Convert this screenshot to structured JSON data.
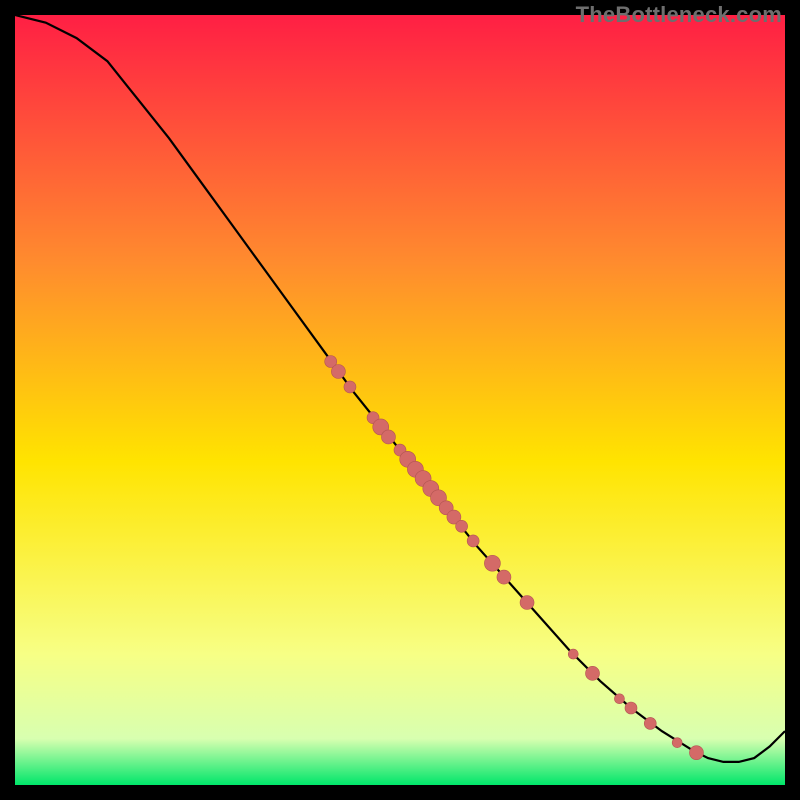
{
  "watermark": "TheBottleneck.com",
  "colors": {
    "gradient_top": "#ff1f44",
    "gradient_mid_upper": "#ff8b2e",
    "gradient_mid": "#ffe400",
    "gradient_lower": "#f7ff85",
    "gradient_near_bottom": "#d8ffb0",
    "gradient_bottom": "#00e66a",
    "line": "#000000",
    "point_fill": "#d46a67",
    "point_stroke": "#b35552"
  },
  "chart_data": {
    "type": "line",
    "xlabel": "",
    "ylabel": "",
    "xlim": [
      0,
      100
    ],
    "ylim": [
      0,
      100
    ],
    "grid": false,
    "legend": false,
    "series": [
      {
        "name": "curve",
        "x": [
          0,
          4,
          8,
          12,
          16,
          20,
          24,
          28,
          32,
          36,
          40,
          44,
          48,
          52,
          56,
          60,
          64,
          68,
          72,
          76,
          80,
          84,
          88,
          90,
          92,
          94,
          96,
          98,
          100
        ],
        "y": [
          100,
          99,
          97,
          94,
          89,
          84,
          78.5,
          73,
          67.5,
          62,
          56.5,
          51,
          46,
          41,
          36,
          31,
          26.5,
          22,
          17.5,
          13.5,
          10,
          7,
          4.5,
          3.5,
          3,
          3,
          3.5,
          5,
          7
        ]
      }
    ],
    "points": [
      {
        "x": 41.0,
        "y": 55.0,
        "r": 6
      },
      {
        "x": 42.0,
        "y": 53.7,
        "r": 7
      },
      {
        "x": 43.5,
        "y": 51.7,
        "r": 6
      },
      {
        "x": 46.5,
        "y": 47.7,
        "r": 6
      },
      {
        "x": 47.5,
        "y": 46.5,
        "r": 8
      },
      {
        "x": 48.5,
        "y": 45.2,
        "r": 7
      },
      {
        "x": 50.0,
        "y": 43.5,
        "r": 6
      },
      {
        "x": 51.0,
        "y": 42.3,
        "r": 8
      },
      {
        "x": 52.0,
        "y": 41.0,
        "r": 8
      },
      {
        "x": 53.0,
        "y": 39.8,
        "r": 8
      },
      {
        "x": 54.0,
        "y": 38.5,
        "r": 8
      },
      {
        "x": 55.0,
        "y": 37.3,
        "r": 8
      },
      {
        "x": 56.0,
        "y": 36.0,
        "r": 7
      },
      {
        "x": 57.0,
        "y": 34.8,
        "r": 7
      },
      {
        "x": 58.0,
        "y": 33.6,
        "r": 6
      },
      {
        "x": 59.5,
        "y": 31.7,
        "r": 6
      },
      {
        "x": 62.0,
        "y": 28.8,
        "r": 8
      },
      {
        "x": 63.5,
        "y": 27.0,
        "r": 7
      },
      {
        "x": 66.5,
        "y": 23.7,
        "r": 7
      },
      {
        "x": 72.5,
        "y": 17.0,
        "r": 5
      },
      {
        "x": 75.0,
        "y": 14.5,
        "r": 7
      },
      {
        "x": 78.5,
        "y": 11.2,
        "r": 5
      },
      {
        "x": 80.0,
        "y": 10.0,
        "r": 6
      },
      {
        "x": 82.5,
        "y": 8.0,
        "r": 6
      },
      {
        "x": 86.0,
        "y": 5.5,
        "r": 5
      },
      {
        "x": 88.5,
        "y": 4.2,
        "r": 7
      }
    ]
  }
}
